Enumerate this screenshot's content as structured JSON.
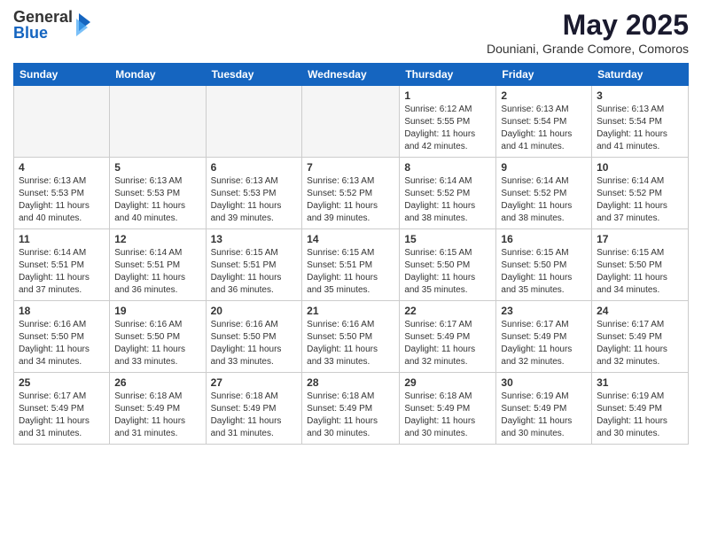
{
  "header": {
    "logo": {
      "general": "General",
      "blue": "Blue"
    },
    "title": "May 2025",
    "subtitle": "Douniani, Grande Comore, Comoros"
  },
  "calendar": {
    "days": [
      "Sunday",
      "Monday",
      "Tuesday",
      "Wednesday",
      "Thursday",
      "Friday",
      "Saturday"
    ],
    "weeks": [
      {
        "cells": [
          {
            "empty": true
          },
          {
            "empty": true
          },
          {
            "empty": true
          },
          {
            "empty": true
          },
          {
            "day": 1,
            "sunrise": "6:12 AM",
            "sunset": "5:55 PM",
            "daylight": "11 hours and 42 minutes."
          },
          {
            "day": 2,
            "sunrise": "6:13 AM",
            "sunset": "5:54 PM",
            "daylight": "11 hours and 41 minutes."
          },
          {
            "day": 3,
            "sunrise": "6:13 AM",
            "sunset": "5:54 PM",
            "daylight": "11 hours and 41 minutes."
          }
        ]
      },
      {
        "cells": [
          {
            "day": 4,
            "sunrise": "6:13 AM",
            "sunset": "5:53 PM",
            "daylight": "11 hours and 40 minutes."
          },
          {
            "day": 5,
            "sunrise": "6:13 AM",
            "sunset": "5:53 PM",
            "daylight": "11 hours and 40 minutes."
          },
          {
            "day": 6,
            "sunrise": "6:13 AM",
            "sunset": "5:53 PM",
            "daylight": "11 hours and 39 minutes."
          },
          {
            "day": 7,
            "sunrise": "6:13 AM",
            "sunset": "5:52 PM",
            "daylight": "11 hours and 39 minutes."
          },
          {
            "day": 8,
            "sunrise": "6:14 AM",
            "sunset": "5:52 PM",
            "daylight": "11 hours and 38 minutes."
          },
          {
            "day": 9,
            "sunrise": "6:14 AM",
            "sunset": "5:52 PM",
            "daylight": "11 hours and 38 minutes."
          },
          {
            "day": 10,
            "sunrise": "6:14 AM",
            "sunset": "5:52 PM",
            "daylight": "11 hours and 37 minutes."
          }
        ]
      },
      {
        "cells": [
          {
            "day": 11,
            "sunrise": "6:14 AM",
            "sunset": "5:51 PM",
            "daylight": "11 hours and 37 minutes."
          },
          {
            "day": 12,
            "sunrise": "6:14 AM",
            "sunset": "5:51 PM",
            "daylight": "11 hours and 36 minutes."
          },
          {
            "day": 13,
            "sunrise": "6:15 AM",
            "sunset": "5:51 PM",
            "daylight": "11 hours and 36 minutes."
          },
          {
            "day": 14,
            "sunrise": "6:15 AM",
            "sunset": "5:51 PM",
            "daylight": "11 hours and 35 minutes."
          },
          {
            "day": 15,
            "sunrise": "6:15 AM",
            "sunset": "5:50 PM",
            "daylight": "11 hours and 35 minutes."
          },
          {
            "day": 16,
            "sunrise": "6:15 AM",
            "sunset": "5:50 PM",
            "daylight": "11 hours and 35 minutes."
          },
          {
            "day": 17,
            "sunrise": "6:15 AM",
            "sunset": "5:50 PM",
            "daylight": "11 hours and 34 minutes."
          }
        ]
      },
      {
        "cells": [
          {
            "day": 18,
            "sunrise": "6:16 AM",
            "sunset": "5:50 PM",
            "daylight": "11 hours and 34 minutes."
          },
          {
            "day": 19,
            "sunrise": "6:16 AM",
            "sunset": "5:50 PM",
            "daylight": "11 hours and 33 minutes."
          },
          {
            "day": 20,
            "sunrise": "6:16 AM",
            "sunset": "5:50 PM",
            "daylight": "11 hours and 33 minutes."
          },
          {
            "day": 21,
            "sunrise": "6:16 AM",
            "sunset": "5:50 PM",
            "daylight": "11 hours and 33 minutes."
          },
          {
            "day": 22,
            "sunrise": "6:17 AM",
            "sunset": "5:49 PM",
            "daylight": "11 hours and 32 minutes."
          },
          {
            "day": 23,
            "sunrise": "6:17 AM",
            "sunset": "5:49 PM",
            "daylight": "11 hours and 32 minutes."
          },
          {
            "day": 24,
            "sunrise": "6:17 AM",
            "sunset": "5:49 PM",
            "daylight": "11 hours and 32 minutes."
          }
        ]
      },
      {
        "cells": [
          {
            "day": 25,
            "sunrise": "6:17 AM",
            "sunset": "5:49 PM",
            "daylight": "11 hours and 31 minutes."
          },
          {
            "day": 26,
            "sunrise": "6:18 AM",
            "sunset": "5:49 PM",
            "daylight": "11 hours and 31 minutes."
          },
          {
            "day": 27,
            "sunrise": "6:18 AM",
            "sunset": "5:49 PM",
            "daylight": "11 hours and 31 minutes."
          },
          {
            "day": 28,
            "sunrise": "6:18 AM",
            "sunset": "5:49 PM",
            "daylight": "11 hours and 30 minutes."
          },
          {
            "day": 29,
            "sunrise": "6:18 AM",
            "sunset": "5:49 PM",
            "daylight": "11 hours and 30 minutes."
          },
          {
            "day": 30,
            "sunrise": "6:19 AM",
            "sunset": "5:49 PM",
            "daylight": "11 hours and 30 minutes."
          },
          {
            "day": 31,
            "sunrise": "6:19 AM",
            "sunset": "5:49 PM",
            "daylight": "11 hours and 30 minutes."
          }
        ]
      }
    ]
  }
}
